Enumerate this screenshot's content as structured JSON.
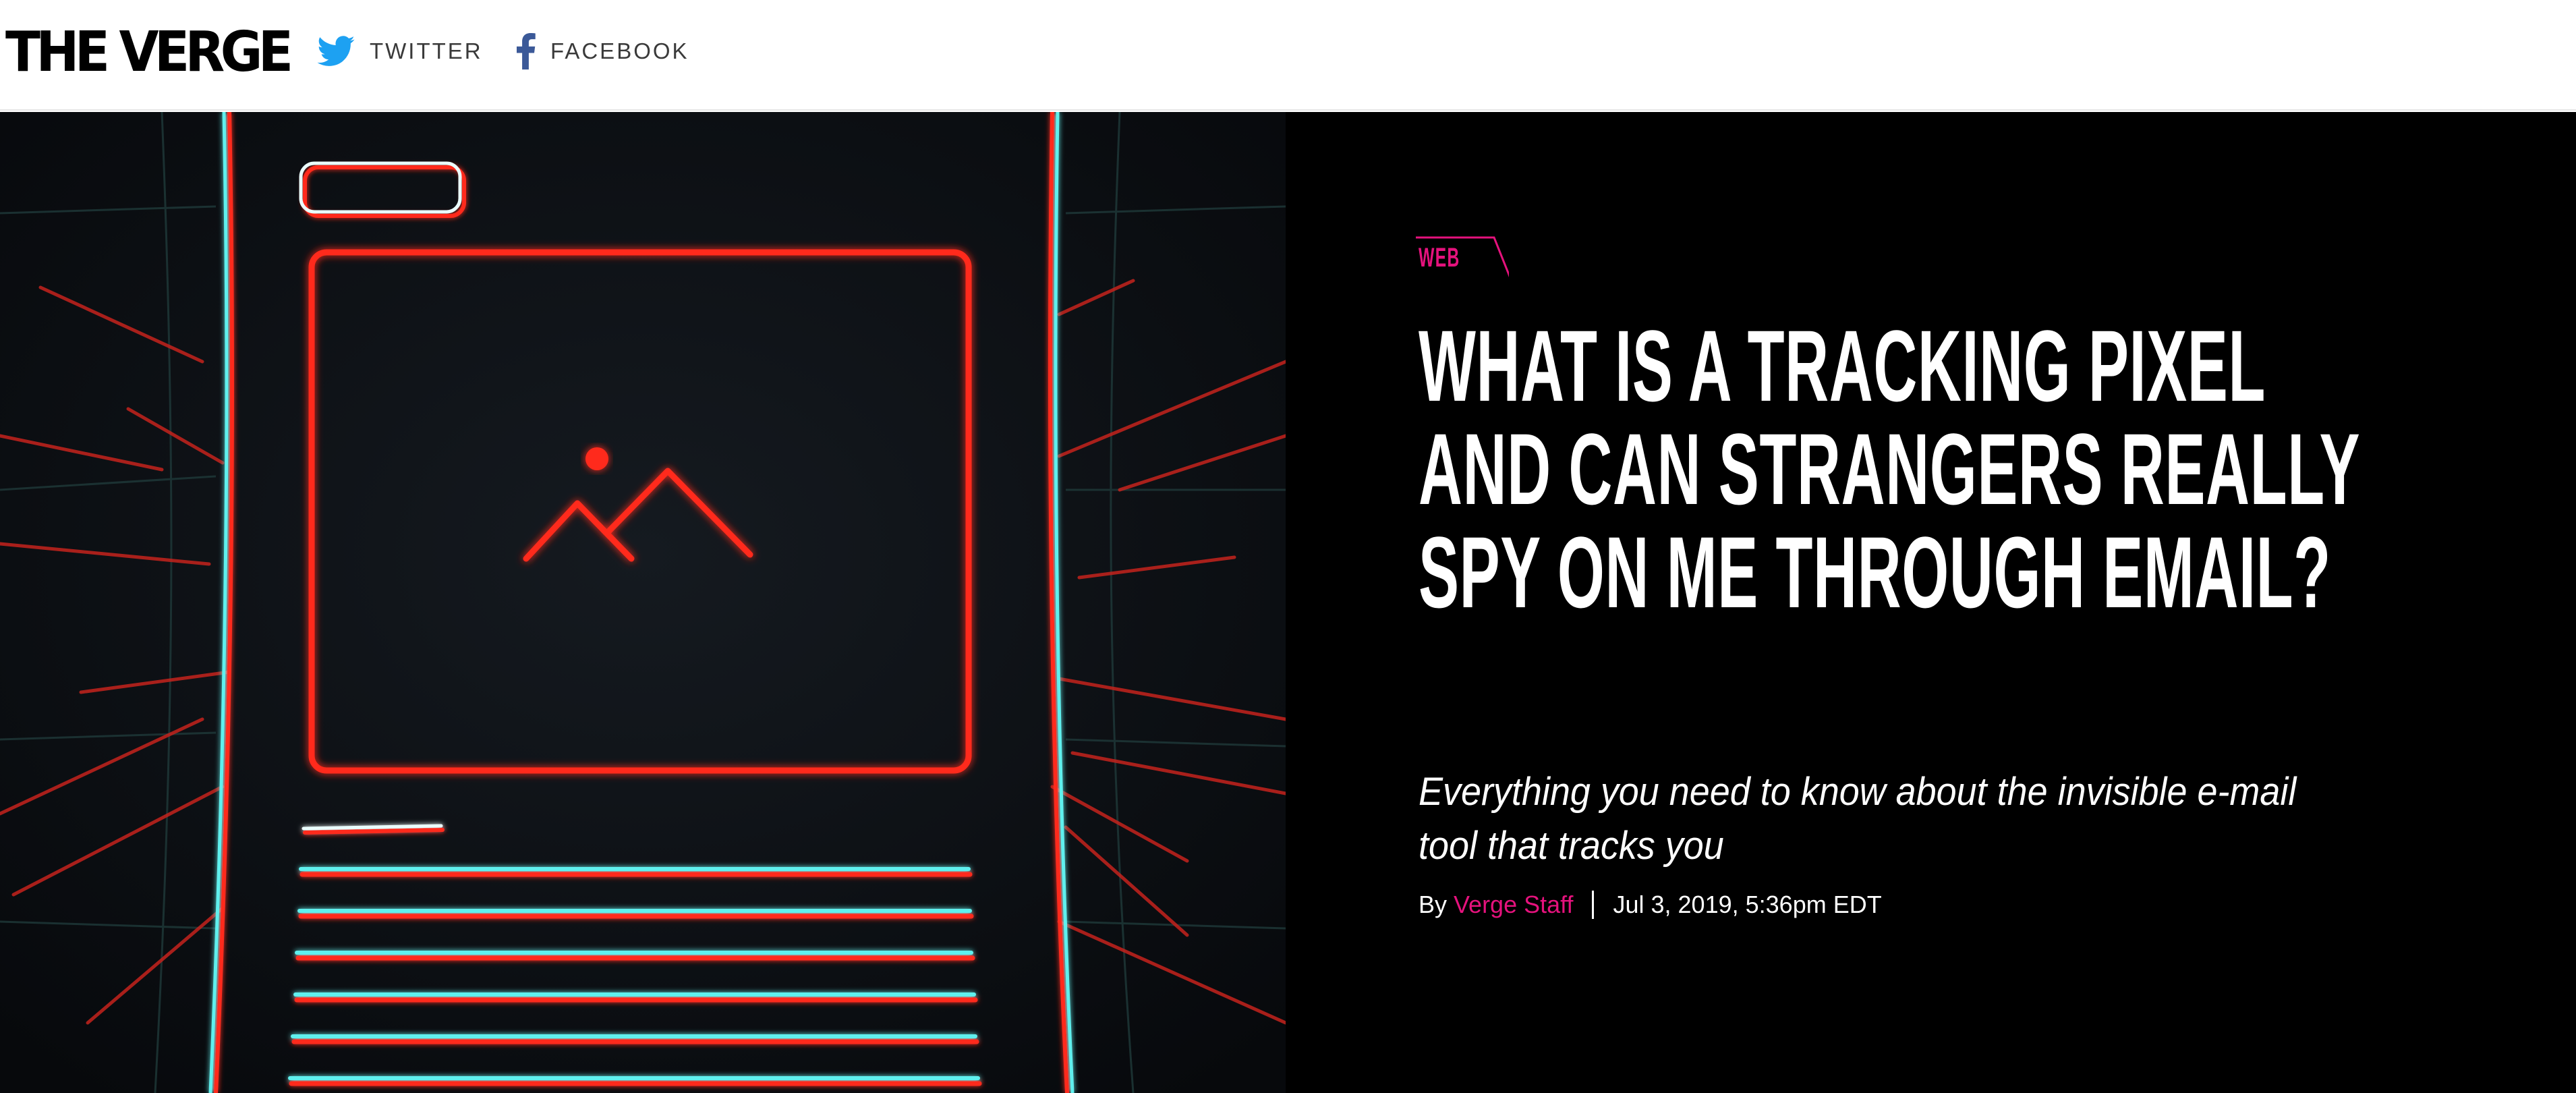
{
  "header": {
    "logo_text": "THE VERGE",
    "social": [
      {
        "label": "TWITTER",
        "icon": "twitter-bird-icon",
        "color": "#1da1f2"
      },
      {
        "label": "FACEBOOK",
        "icon": "facebook-f-icon",
        "color": "#3b5998"
      }
    ]
  },
  "article": {
    "category": "WEB",
    "title": "WHAT IS A TRACKING PIXEL AND CAN STRANGERS REALLY SPY ON ME THROUGH EMAIL?",
    "dek": "Everything you need to know about the invisible e-mail tool that tracks you",
    "byline_prefix": "By",
    "author": "Verge Staff",
    "timestamp": "Jul 3, 2019, 5:36pm EDT",
    "hero_image_icon": "email-tracking-pixel-illustration"
  },
  "colors": {
    "accent": "#e5127d",
    "hero_background": "#000000",
    "image_background": "#0d1014",
    "neon_red": "#ff2a1a",
    "neon_cyan": "#5ff0ee"
  }
}
